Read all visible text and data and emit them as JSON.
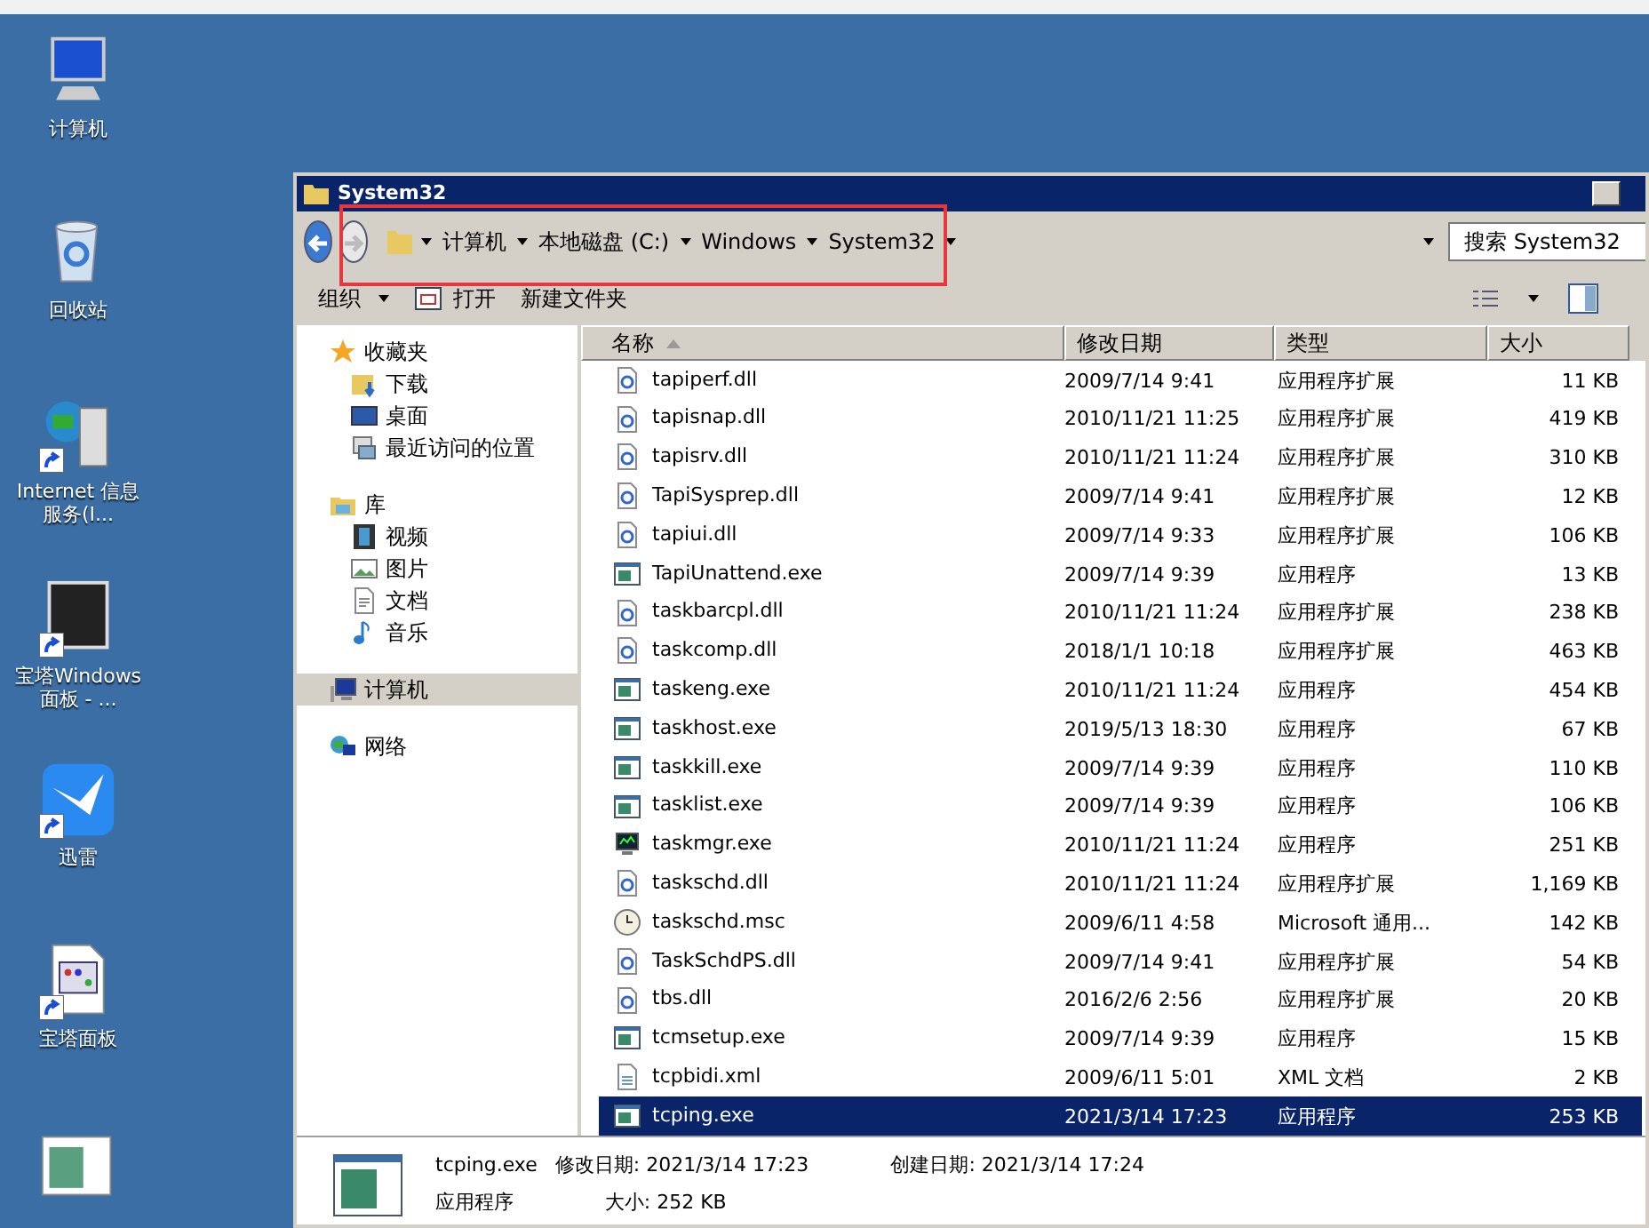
{
  "desktop_icons": [
    {
      "label": "计算机",
      "shortcut": false
    },
    {
      "label": "回收站",
      "shortcut": false
    },
    {
      "label": "Internet 信息服务(I...",
      "shortcut": true
    },
    {
      "label": "宝塔Windows面板 - ...",
      "shortcut": true
    },
    {
      "label": "迅雷",
      "shortcut": true
    },
    {
      "label": "宝塔面板",
      "shortcut": true
    },
    {
      "shortcut": false
    }
  ],
  "window": {
    "title": "System32",
    "address": {
      "crumbs": [
        "计算机",
        "本地磁盘 (C:)",
        "Windows",
        "System32"
      ],
      "highlighted": true
    },
    "search": {
      "placeholder": "搜索 System32"
    },
    "toolbar": [
      {
        "label": "组织",
        "kind": "menu"
      },
      {
        "label": "打开",
        "kind": "open"
      },
      {
        "label": "新建文件夹",
        "kind": "plain"
      }
    ],
    "nav": [
      {
        "label": "收藏夹",
        "selected": false,
        "children": [
          {
            "label": "下载",
            "selected": false
          },
          {
            "label": "桌面",
            "selected": false
          },
          {
            "label": "最近访问的位置",
            "selected": false
          }
        ]
      },
      {
        "label": "库",
        "selected": false,
        "children": [
          {
            "label": "视频",
            "selected": false
          },
          {
            "label": "图片",
            "selected": false
          },
          {
            "label": "文档",
            "selected": false
          },
          {
            "label": "音乐",
            "selected": false
          }
        ]
      },
      {
        "label": "计算机",
        "selected": true
      },
      {
        "label": "网络",
        "selected": false
      }
    ],
    "columns": [
      {
        "label": "名称",
        "sorted": true
      },
      {
        "label": "修改日期",
        "sorted": false
      },
      {
        "label": "类型",
        "sorted": false
      },
      {
        "label": "大小",
        "sorted": false
      }
    ],
    "rows": [
      {
        "name": "tapiperf.dll",
        "kind": "dll",
        "date": "2009/7/14 9:41",
        "type": "应用程序扩展",
        "size": "11 KB",
        "selected": false
      },
      {
        "name": "tapisnap.dll",
        "kind": "dll",
        "date": "2010/11/21 11:25",
        "type": "应用程序扩展",
        "size": "419 KB",
        "selected": false
      },
      {
        "name": "tapisrv.dll",
        "kind": "dll",
        "date": "2010/11/21 11:24",
        "type": "应用程序扩展",
        "size": "310 KB",
        "selected": false
      },
      {
        "name": "TapiSysprep.dll",
        "kind": "dll",
        "date": "2009/7/14 9:41",
        "type": "应用程序扩展",
        "size": "12 KB",
        "selected": false
      },
      {
        "name": "tapiui.dll",
        "kind": "dll",
        "date": "2009/7/14 9:33",
        "type": "应用程序扩展",
        "size": "106 KB",
        "selected": false
      },
      {
        "name": "TapiUnattend.exe",
        "kind": "exe",
        "date": "2009/7/14 9:39",
        "type": "应用程序",
        "size": "13 KB",
        "selected": false
      },
      {
        "name": "taskbarcpl.dll",
        "kind": "dll",
        "date": "2010/11/21 11:24",
        "type": "应用程序扩展",
        "size": "238 KB",
        "selected": false
      },
      {
        "name": "taskcomp.dll",
        "kind": "dll",
        "date": "2018/1/1 10:18",
        "type": "应用程序扩展",
        "size": "463 KB",
        "selected": false
      },
      {
        "name": "taskeng.exe",
        "kind": "exe",
        "date": "2010/11/21 11:24",
        "type": "应用程序",
        "size": "454 KB",
        "selected": false
      },
      {
        "name": "taskhost.exe",
        "kind": "exe",
        "date": "2019/5/13 18:30",
        "type": "应用程序",
        "size": "67 KB",
        "selected": false
      },
      {
        "name": "taskkill.exe",
        "kind": "exe",
        "date": "2009/7/14 9:39",
        "type": "应用程序",
        "size": "110 KB",
        "selected": false
      },
      {
        "name": "tasklist.exe",
        "kind": "exe",
        "date": "2009/7/14 9:39",
        "type": "应用程序",
        "size": "106 KB",
        "selected": false
      },
      {
        "name": "taskmgr.exe",
        "kind": "monitor",
        "date": "2010/11/21 11:24",
        "type": "应用程序",
        "size": "251 KB",
        "selected": false
      },
      {
        "name": "taskschd.dll",
        "kind": "dll",
        "date": "2010/11/21 11:24",
        "type": "应用程序扩展",
        "size": "1,169 KB",
        "selected": false
      },
      {
        "name": "taskschd.msc",
        "kind": "clock",
        "date": "2009/6/11 4:58",
        "type": "Microsoft 通用...",
        "size": "142 KB",
        "selected": false
      },
      {
        "name": "TaskSchdPS.dll",
        "kind": "dll",
        "date": "2009/7/14 9:41",
        "type": "应用程序扩展",
        "size": "54 KB",
        "selected": false
      },
      {
        "name": "tbs.dll",
        "kind": "dll",
        "date": "2016/2/6 2:56",
        "type": "应用程序扩展",
        "size": "20 KB",
        "selected": false
      },
      {
        "name": "tcmsetup.exe",
        "kind": "exe",
        "date": "2009/7/14 9:39",
        "type": "应用程序",
        "size": "15 KB",
        "selected": false
      },
      {
        "name": "tcpbidi.xml",
        "kind": "xml",
        "date": "2009/6/11 5:01",
        "type": "XML 文档",
        "size": "2 KB",
        "selected": false
      },
      {
        "name": "tcping.exe",
        "kind": "exe",
        "date": "2021/3/14 17:23",
        "type": "应用程序",
        "size": "253 KB",
        "selected": true
      }
    ],
    "details": {
      "name": "tcping.exe",
      "type": "应用程序",
      "fields": [
        {
          "label": "修改日期:",
          "value": "2021/3/14 17:23"
        },
        {
          "label": "创建日期:",
          "value": "2021/3/14 17:24"
        },
        {
          "label": "大小:",
          "value": "252 KB"
        }
      ]
    }
  }
}
